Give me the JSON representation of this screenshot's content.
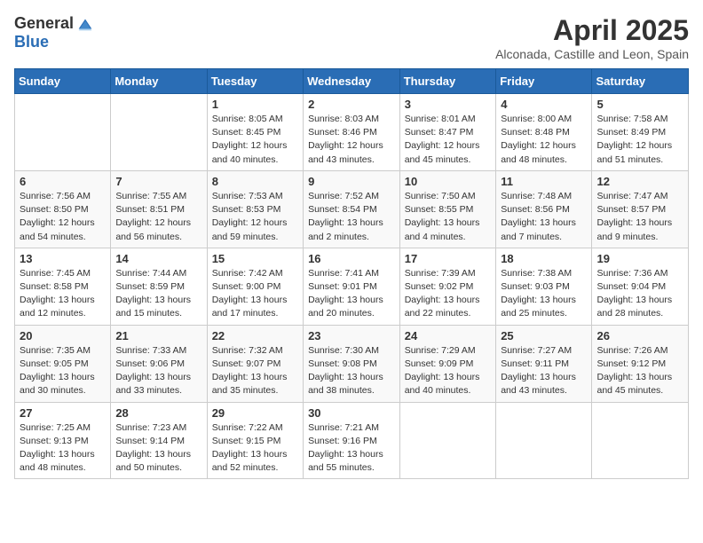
{
  "header": {
    "logo_general": "General",
    "logo_blue": "Blue",
    "month_title": "April 2025",
    "subtitle": "Alconada, Castille and Leon, Spain"
  },
  "days_of_week": [
    "Sunday",
    "Monday",
    "Tuesday",
    "Wednesday",
    "Thursday",
    "Friday",
    "Saturday"
  ],
  "weeks": [
    [
      {
        "day": "",
        "info": ""
      },
      {
        "day": "",
        "info": ""
      },
      {
        "day": "1",
        "info": "Sunrise: 8:05 AM\nSunset: 8:45 PM\nDaylight: 12 hours and 40 minutes."
      },
      {
        "day": "2",
        "info": "Sunrise: 8:03 AM\nSunset: 8:46 PM\nDaylight: 12 hours and 43 minutes."
      },
      {
        "day": "3",
        "info": "Sunrise: 8:01 AM\nSunset: 8:47 PM\nDaylight: 12 hours and 45 minutes."
      },
      {
        "day": "4",
        "info": "Sunrise: 8:00 AM\nSunset: 8:48 PM\nDaylight: 12 hours and 48 minutes."
      },
      {
        "day": "5",
        "info": "Sunrise: 7:58 AM\nSunset: 8:49 PM\nDaylight: 12 hours and 51 minutes."
      }
    ],
    [
      {
        "day": "6",
        "info": "Sunrise: 7:56 AM\nSunset: 8:50 PM\nDaylight: 12 hours and 54 minutes."
      },
      {
        "day": "7",
        "info": "Sunrise: 7:55 AM\nSunset: 8:51 PM\nDaylight: 12 hours and 56 minutes."
      },
      {
        "day": "8",
        "info": "Sunrise: 7:53 AM\nSunset: 8:53 PM\nDaylight: 12 hours and 59 minutes."
      },
      {
        "day": "9",
        "info": "Sunrise: 7:52 AM\nSunset: 8:54 PM\nDaylight: 13 hours and 2 minutes."
      },
      {
        "day": "10",
        "info": "Sunrise: 7:50 AM\nSunset: 8:55 PM\nDaylight: 13 hours and 4 minutes."
      },
      {
        "day": "11",
        "info": "Sunrise: 7:48 AM\nSunset: 8:56 PM\nDaylight: 13 hours and 7 minutes."
      },
      {
        "day": "12",
        "info": "Sunrise: 7:47 AM\nSunset: 8:57 PM\nDaylight: 13 hours and 9 minutes."
      }
    ],
    [
      {
        "day": "13",
        "info": "Sunrise: 7:45 AM\nSunset: 8:58 PM\nDaylight: 13 hours and 12 minutes."
      },
      {
        "day": "14",
        "info": "Sunrise: 7:44 AM\nSunset: 8:59 PM\nDaylight: 13 hours and 15 minutes."
      },
      {
        "day": "15",
        "info": "Sunrise: 7:42 AM\nSunset: 9:00 PM\nDaylight: 13 hours and 17 minutes."
      },
      {
        "day": "16",
        "info": "Sunrise: 7:41 AM\nSunset: 9:01 PM\nDaylight: 13 hours and 20 minutes."
      },
      {
        "day": "17",
        "info": "Sunrise: 7:39 AM\nSunset: 9:02 PM\nDaylight: 13 hours and 22 minutes."
      },
      {
        "day": "18",
        "info": "Sunrise: 7:38 AM\nSunset: 9:03 PM\nDaylight: 13 hours and 25 minutes."
      },
      {
        "day": "19",
        "info": "Sunrise: 7:36 AM\nSunset: 9:04 PM\nDaylight: 13 hours and 28 minutes."
      }
    ],
    [
      {
        "day": "20",
        "info": "Sunrise: 7:35 AM\nSunset: 9:05 PM\nDaylight: 13 hours and 30 minutes."
      },
      {
        "day": "21",
        "info": "Sunrise: 7:33 AM\nSunset: 9:06 PM\nDaylight: 13 hours and 33 minutes."
      },
      {
        "day": "22",
        "info": "Sunrise: 7:32 AM\nSunset: 9:07 PM\nDaylight: 13 hours and 35 minutes."
      },
      {
        "day": "23",
        "info": "Sunrise: 7:30 AM\nSunset: 9:08 PM\nDaylight: 13 hours and 38 minutes."
      },
      {
        "day": "24",
        "info": "Sunrise: 7:29 AM\nSunset: 9:09 PM\nDaylight: 13 hours and 40 minutes."
      },
      {
        "day": "25",
        "info": "Sunrise: 7:27 AM\nSunset: 9:11 PM\nDaylight: 13 hours and 43 minutes."
      },
      {
        "day": "26",
        "info": "Sunrise: 7:26 AM\nSunset: 9:12 PM\nDaylight: 13 hours and 45 minutes."
      }
    ],
    [
      {
        "day": "27",
        "info": "Sunrise: 7:25 AM\nSunset: 9:13 PM\nDaylight: 13 hours and 48 minutes."
      },
      {
        "day": "28",
        "info": "Sunrise: 7:23 AM\nSunset: 9:14 PM\nDaylight: 13 hours and 50 minutes."
      },
      {
        "day": "29",
        "info": "Sunrise: 7:22 AM\nSunset: 9:15 PM\nDaylight: 13 hours and 52 minutes."
      },
      {
        "day": "30",
        "info": "Sunrise: 7:21 AM\nSunset: 9:16 PM\nDaylight: 13 hours and 55 minutes."
      },
      {
        "day": "",
        "info": ""
      },
      {
        "day": "",
        "info": ""
      },
      {
        "day": "",
        "info": ""
      }
    ]
  ]
}
